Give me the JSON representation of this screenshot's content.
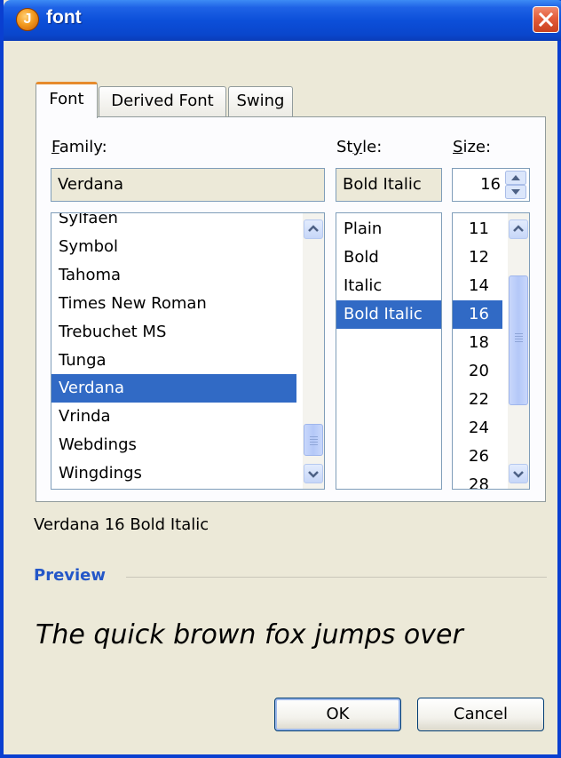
{
  "window": {
    "title": "font"
  },
  "tabs": [
    {
      "label": "Font",
      "active": true
    },
    {
      "label": "Derived Font",
      "active": false
    },
    {
      "label": "Swing",
      "active": false
    }
  ],
  "labels": {
    "family_prefix": "F",
    "family_rest": "amily:",
    "style_pre": "St",
    "style_u": "y",
    "style_post": "le:",
    "size_prefix": "S",
    "size_rest": "ize:"
  },
  "fields": {
    "family_value": "Verdana",
    "style_value": "Bold Italic",
    "size_value": "16"
  },
  "family_list": {
    "partial_top": "Sylfaen",
    "items": [
      "Symbol",
      "Tahoma",
      "Times New Roman",
      "Trebuchet MS",
      "Tunga",
      "Verdana",
      "Vrinda",
      "Webdings",
      "Wingdings"
    ],
    "selected": "Verdana"
  },
  "style_list": {
    "items": [
      "Plain",
      "Bold",
      "Italic",
      "Bold Italic"
    ],
    "selected": "Bold Italic"
  },
  "size_list": {
    "items": [
      "11",
      "12",
      "14",
      "16",
      "18",
      "20",
      "22",
      "24",
      "26"
    ],
    "partial_bottom": "28",
    "selected": "16"
  },
  "summary": "Verdana 16 Bold Italic",
  "preview": {
    "label": "Preview",
    "text": "The quick brown fox jumps over"
  },
  "buttons": {
    "ok": "OK",
    "cancel": "Cancel"
  },
  "colors": {
    "selection": "#316ac5",
    "title_bar": "#0c4fd9",
    "preview_label": "#2457c8",
    "active_tab_accent": "#e68b2c"
  },
  "icons": {
    "app": "java-icon",
    "close": "close-icon",
    "spin": "spinner-arrows-icon"
  }
}
